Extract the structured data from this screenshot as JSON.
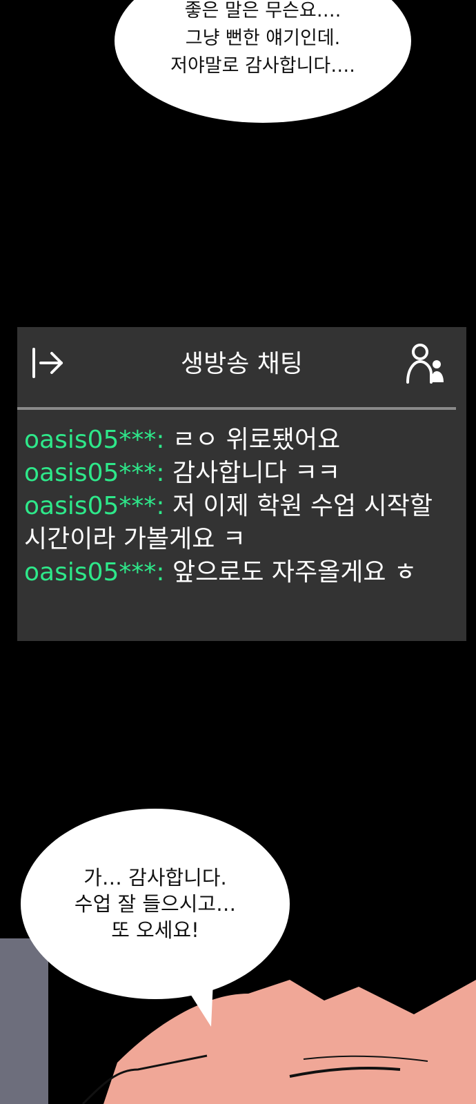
{
  "speech_top": {
    "lines": [
      "좋은 말은 무슨요….",
      "그냥 뻔한 얘기인데.",
      "저야말로 감사합니다…."
    ]
  },
  "chat": {
    "title": "생방송 채팅",
    "exit_icon": "exit-arrow-icon",
    "users_icon": "users-icon",
    "username_color": "#2ee88a",
    "messages": [
      {
        "user": "oasis05***:",
        "text": " ㄹㅇ 위로됐어요"
      },
      {
        "user": "oasis05***:",
        "text": " 감사합니다 ㅋㅋ"
      },
      {
        "user": "oasis05***:",
        "text": " 저 이제 학원 수업 시작할 시간이라 가볼게요 ㅋ"
      },
      {
        "user": "oasis05***:",
        "text": " 앞으로도 자주올게요 ㅎ"
      }
    ]
  },
  "speech_bottom": {
    "lines": [
      "가… 감사합니다.",
      "수업 잘 들으시고…",
      "또 오세요!"
    ]
  }
}
